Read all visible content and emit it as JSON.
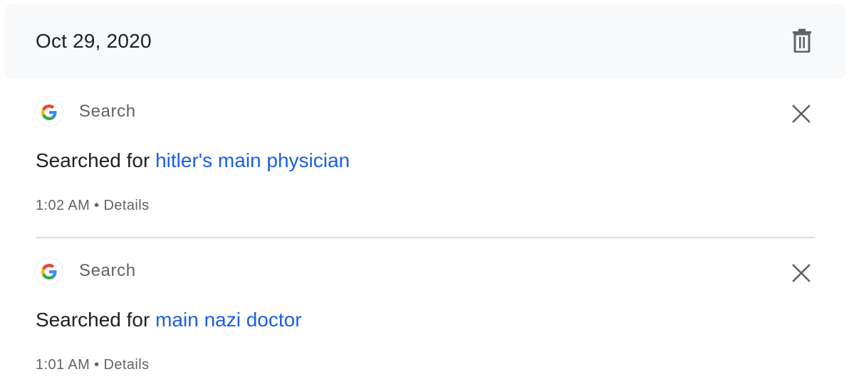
{
  "date_group": {
    "date": "Oct 29, 2020",
    "delete_icon": "trash-icon"
  },
  "entries": [
    {
      "product_icon": "google-g-icon",
      "product": "Search",
      "prefix": "Searched for",
      "query": "hitler's main physician",
      "time": "1:02 AM",
      "separator": "•",
      "details": "Details",
      "remove_icon": "close-icon"
    },
    {
      "product_icon": "google-g-icon",
      "product": "Search",
      "prefix": "Searched for",
      "query": "main nazi doctor",
      "time": "1:01 AM",
      "separator": "•",
      "details": "Details",
      "remove_icon": "close-icon"
    }
  ],
  "colors": {
    "link": "#1a5ee8",
    "secondary_text": "#5f6368",
    "primary_text": "#202124",
    "header_bg": "#f8f9fa",
    "divider": "#dadce0"
  }
}
